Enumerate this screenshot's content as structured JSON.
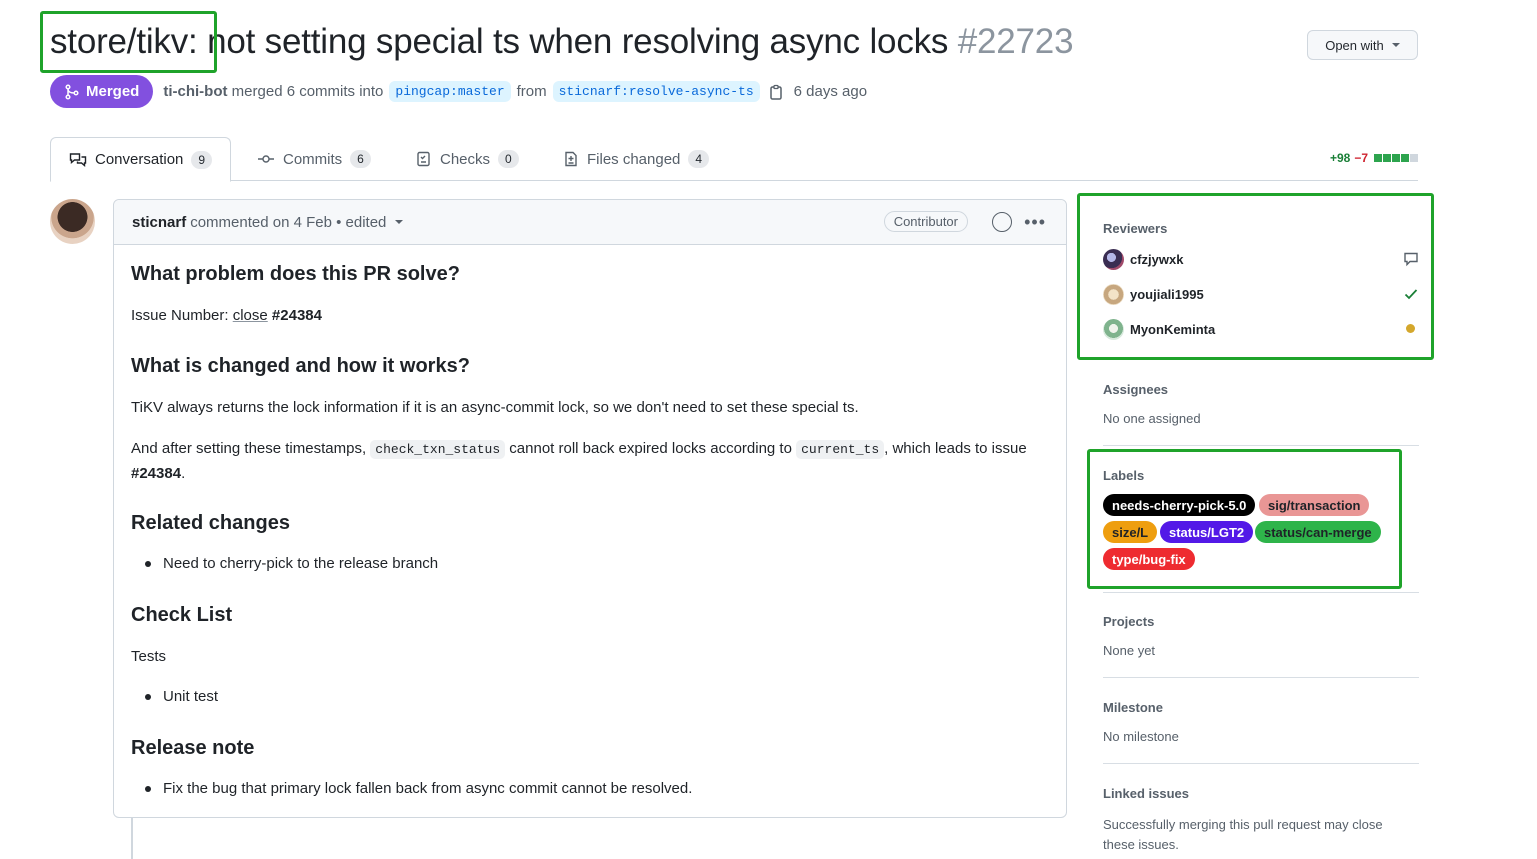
{
  "header": {
    "title_prefix": "store/tikv:",
    "title_rest": " not setting special ts when resolving async locks",
    "pr_number": "#22723",
    "open_with_label": "Open with"
  },
  "meta": {
    "state": "Merged",
    "author": "ti-chi-bot",
    "merged_text": "merged 6 commits into",
    "base_branch": "pingcap:master",
    "from_text": "from",
    "head_branch": "sticnarf:resolve-async-ts",
    "time": "6 days ago"
  },
  "tabs": [
    {
      "label": "Conversation",
      "count": "9"
    },
    {
      "label": "Commits",
      "count": "6"
    },
    {
      "label": "Checks",
      "count": "0"
    },
    {
      "label": "Files changed",
      "count": "4"
    }
  ],
  "diffstat": {
    "additions": "+98",
    "deletions": "−7"
  },
  "comment": {
    "author": "sticnarf",
    "meta": "commented on 4 Feb • edited",
    "role": "Contributor",
    "h_problem": "What problem does this PR solve?",
    "issue_label": "Issue Number: ",
    "issue_link": "close",
    "issue_ref": "#24384",
    "h_changed": "What is changed and how it works?",
    "p1": "TiKV always returns the lock information if it is an async-commit lock, so we don't need to set these special ts.",
    "p2_a": "And after setting these timestamps, ",
    "p2_code1": "check_txn_status",
    "p2_b": " cannot roll back expired locks according to ",
    "p2_code2": "current_ts",
    "p2_c": ", which leads to issue",
    "p2_ref": "#24384",
    "p2_end": ".",
    "h_related": "Related changes",
    "related_item": "Need to cherry-pick to the release branch",
    "h_checklist": "Check List",
    "tests": "Tests",
    "test_item": "Unit test",
    "h_release": "Release note",
    "release_item": "Fix the bug that primary lock fallen back from async commit cannot be resolved."
  },
  "sidebar": {
    "reviewers_title": "Reviewers",
    "reviewers": [
      {
        "name": "cfzjywxk",
        "status_icon": "comment-icon"
      },
      {
        "name": "youjiali1995",
        "status_icon": "check-icon"
      },
      {
        "name": "MyonKeminta",
        "status_icon": "pending-dot-icon"
      }
    ],
    "assignees_title": "Assignees",
    "assignees_text": "No one assigned",
    "labels_title": "Labels",
    "labels": [
      {
        "name": "needs-cherry-pick-5.0",
        "bg": "#000000",
        "fg": "#ffffff"
      },
      {
        "name": "sig/transaction",
        "bg": "#e99695",
        "fg": "#1f2328"
      },
      {
        "name": "size/L",
        "bg": "#ee9e0f",
        "fg": "#1f2328"
      },
      {
        "name": "status/LGT2",
        "bg": "#5319e7",
        "fg": "#ffffff"
      },
      {
        "name": "status/can-merge",
        "bg": "#2eb44a",
        "fg": "#1f2328"
      },
      {
        "name": "type/bug-fix",
        "bg": "#ee2b30",
        "fg": "#ffffff"
      }
    ],
    "projects_title": "Projects",
    "projects_text": "None yet",
    "milestone_title": "Milestone",
    "milestone_text": "No milestone",
    "linked_title": "Linked issues",
    "linked_text": "Successfully merging this pull request may close these issues."
  },
  "colors": {
    "highlight": "#1fa32a",
    "merged": "#8250df",
    "link": "#0969da"
  }
}
